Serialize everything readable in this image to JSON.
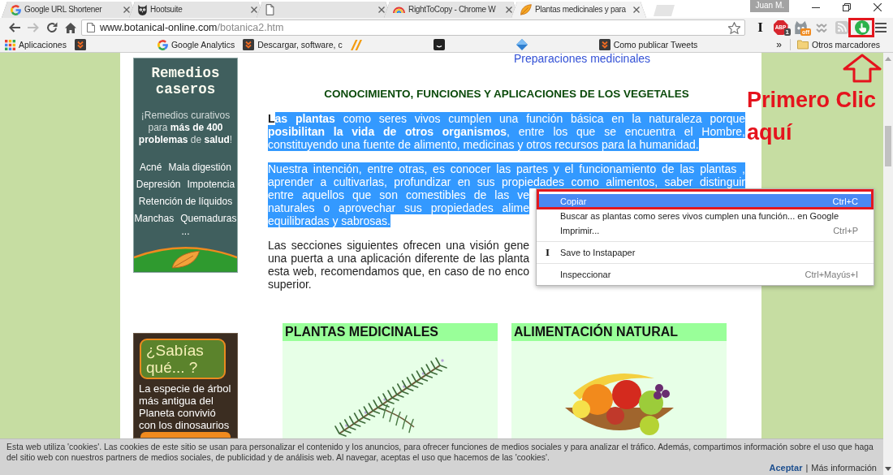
{
  "browser": {
    "tabs": [
      {
        "kind": "google",
        "title": "Google URL Shortener",
        "selected": false
      },
      {
        "kind": "owl",
        "title": "Hootsuite",
        "selected": false
      },
      {
        "kind": "document",
        "selected": false
      },
      {
        "kind": "rainbow",
        "title": "RightToCopy - Chrome W",
        "selected": false
      },
      {
        "kind": "leaf",
        "title": "Plantas medicinales y para",
        "selected": true
      }
    ],
    "profile": "Juan M.",
    "nav_buttons": [
      {
        "kind": "back",
        "disabled": false
      },
      {
        "kind": "forward",
        "disabled": true
      },
      {
        "kind": "reload",
        "disabled": false
      },
      {
        "kind": "home",
        "disabled": false
      }
    ],
    "address": {
      "host": "www.botanical-online.com",
      "path": "/botanica2.htm"
    },
    "extensions": [
      {
        "kind": "glyph",
        "glyph": "I",
        "disabled": false,
        "annotated": false
      },
      {
        "kind": "stop",
        "label": "ABP",
        "badge": "1",
        "disabled": false,
        "annotated": false
      },
      {
        "kind": "cat",
        "badge": "off",
        "disabled": false,
        "annotated": false
      },
      {
        "kind": "chevrons",
        "disabled": true,
        "annotated": false
      },
      {
        "kind": "rss",
        "disabled": true,
        "annotated": false
      },
      {
        "kind": "hand",
        "disabled": false,
        "annotated": true
      }
    ],
    "bookmarks": [
      {
        "kind": "apps",
        "label": "Aplicaciones"
      },
      {
        "kind": "chevron"
      },
      {
        "kind": "google",
        "label": "Google Analytics"
      },
      {
        "kind": "chevron",
        "label": "Descargar, software, c"
      },
      {
        "kind": "stripes"
      },
      {
        "kind": "square"
      },
      {
        "kind": "diamond"
      },
      {
        "kind": "chevron",
        "label": "Como publicar Tweets"
      }
    ],
    "bookmarks_overflow": "»",
    "other_bookmarks": "Otros marcadores"
  },
  "page": {
    "top_link": "Preparaciones medicinales",
    "ads": [
      {
        "kind": "remedies",
        "title": "Remedios caseros",
        "text": "¡Remedios curativos para **más de 400 problemas** de **salud**!",
        "conditions": [
          [
            "Acné",
            "Mala digestión"
          ],
          [
            "Depresión",
            "Impotencia"
          ],
          [
            "Retención de líquidos"
          ],
          [
            "Manchas",
            "Quemaduras"
          ]
        ],
        "more": "..."
      },
      {
        "kind": "trivia",
        "title": "¿Sabías qué... ?",
        "text": "La especie de árbol más antigua del Planeta convivió con los dinosaurios"
      }
    ],
    "heading": "CONOCIMIENTO, FUNCIONES Y APLICACIONES DE LOS VEGETALES",
    "paragraphs": [
      {
        "kind": "flow",
        "segments": [
          {
            "text": "**L**",
            "selected": false
          },
          {
            "text": "**as plantas** como seres vivos cumplen una función básica en la naturaleza porque **posibilitan la vida de otros organismos**, entre los que se encuentra el Hombre, constituyendo una fuente de alimento, medicinas y otros recursos para la humanidad.",
            "selected": true
          }
        ]
      },
      {
        "kind": "lines",
        "selected": true,
        "lines": [
          {
            "text": "Nuestra intención, entre otras, es conocer las partes y el funcionamiento de las plantas ,",
            "covered": false
          },
          {
            "text": "aprender a cultivarlas, profundizar en sus propiedades como alimentos, saber distinguir",
            "covered": false
          },
          {
            "text": "entre aquellos que son comestibles de las ve",
            "covered": true
          },
          {
            "text": "naturales o aprovechar sus propiedades alime",
            "covered": true
          },
          {
            "text": "equilibradas y sabrosas.",
            "covered": false
          }
        ]
      },
      {
        "kind": "lines",
        "selected": false,
        "lines": [
          {
            "text": "Las secciones siguientes ofrecen una visión gene",
            "covered": true
          },
          {
            "text": "una puerta a una aplicación diferente de las planta",
            "covered": true
          },
          {
            "text": "esta web, recomendamos que, en caso de no enco",
            "covered": true
          },
          {
            "text": "superior.",
            "covered": false
          }
        ]
      }
    ],
    "sections": [
      {
        "kind": "herbs",
        "title": "PLANTAS MEDICINALES"
      },
      {
        "kind": "fruit",
        "title": "ALIMENTACIÓN NATURAL"
      }
    ]
  },
  "context_menu": {
    "items": [
      {
        "kind": "item",
        "label": "Copiar",
        "shortcut": "Ctrl+C",
        "selected": true,
        "annotated": true
      },
      {
        "kind": "item",
        "label": "Buscar as plantas como seres vivos cumplen una función... en Google",
        "selected": false,
        "annotated": false
      },
      {
        "kind": "item",
        "label": "Imprimir...",
        "shortcut": "Ctrl+P",
        "selected": false,
        "annotated": false
      },
      {
        "kind": "separator"
      },
      {
        "kind": "item",
        "glyph": "I",
        "label": "Save to Instapaper",
        "selected": false,
        "annotated": false
      },
      {
        "kind": "separator"
      },
      {
        "kind": "item",
        "label": "Inspeccionar",
        "shortcut": "Ctrl+Mayús+I",
        "selected": false,
        "annotated": false
      }
    ]
  },
  "annotation": {
    "text": "Primero Clic aquí"
  },
  "cookie_bar": {
    "text": "Esta web utiliza 'cookies'. Las cookies de este sitio se usan para personalizar el contenido y los anuncios, para ofrecer funciones de medios sociales y para analizar el tráfico. Además, compartimos información sobre el uso que haga del sitio web con nuestros partners de medios sociales, de publicidad y de análisis web. Al navegar, aceptas el uso que hacemos de las 'cookies'.",
    "accept": "Aceptar",
    "separator": "|",
    "more": "Más información"
  }
}
